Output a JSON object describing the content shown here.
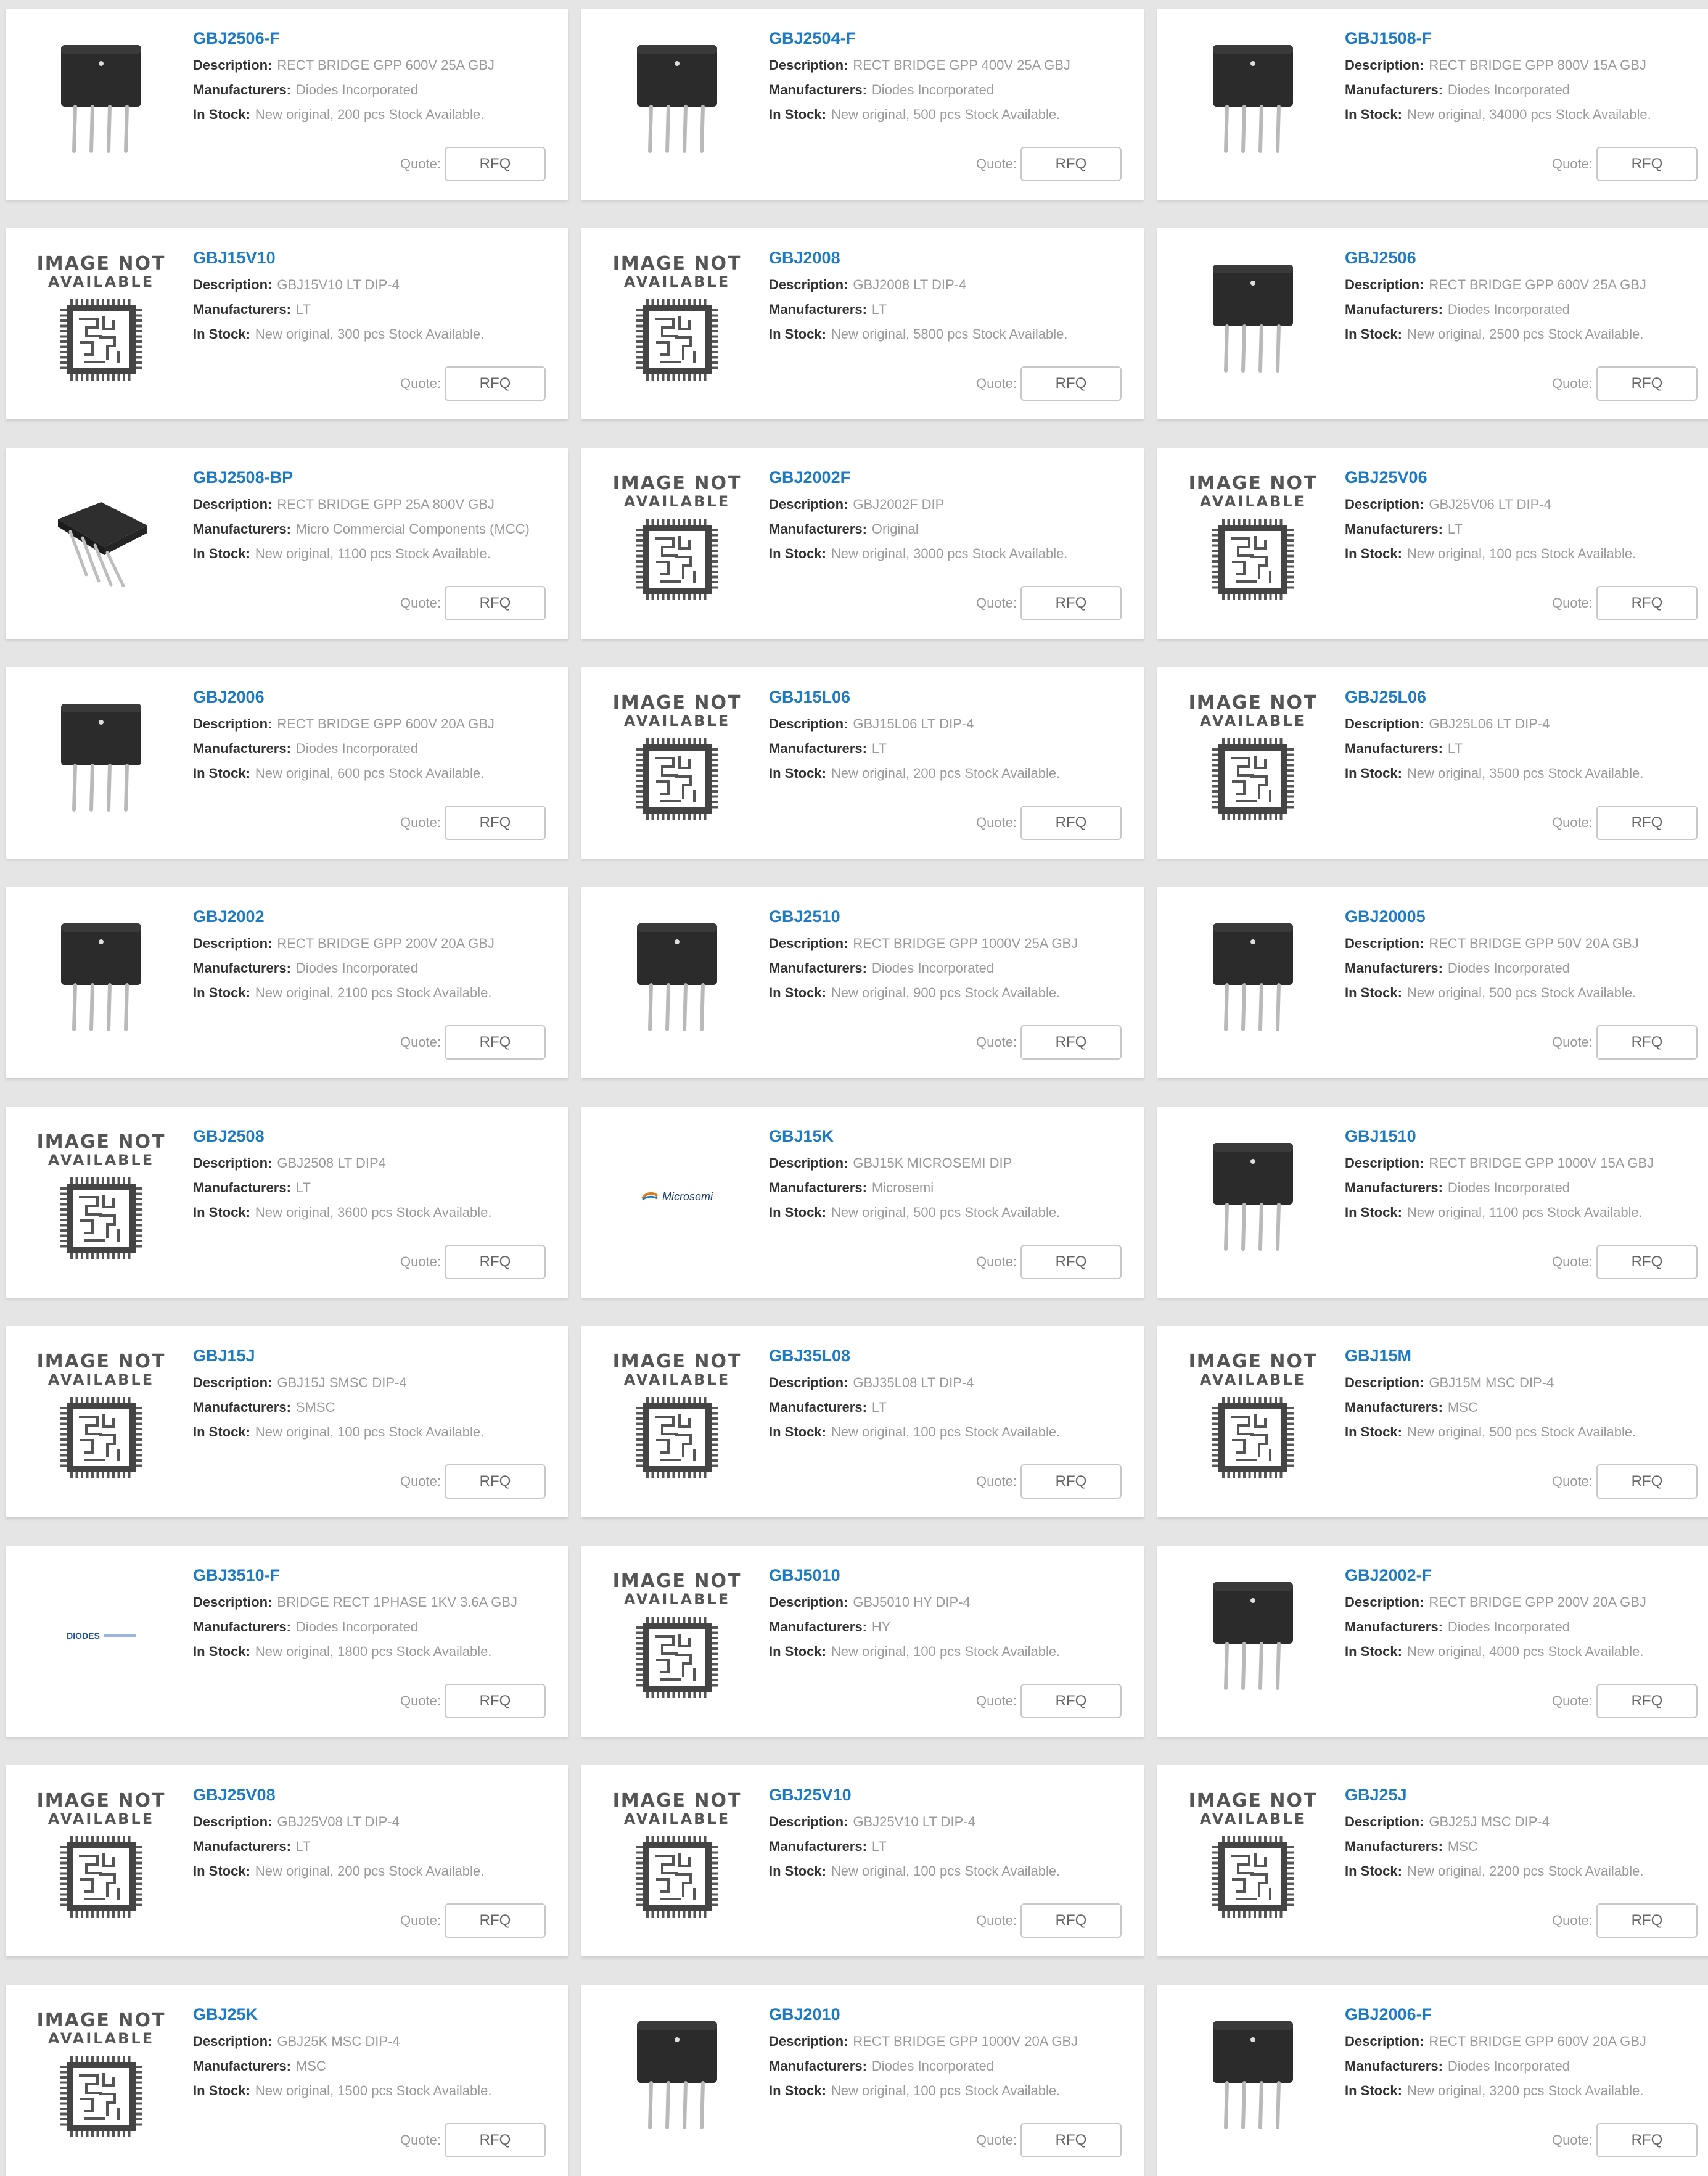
{
  "labels": {
    "description": "Description:",
    "manufacturers": "Manufacturers:",
    "in_stock": "In Stock:",
    "quote": "Quote:",
    "rfq": "RFQ"
  },
  "image_not_available": {
    "line1": "IMAGE NOT",
    "line2": "AVAILABLE"
  },
  "logos": {
    "microsemi": "Microsemi",
    "diodes": "DIODES"
  },
  "products": [
    {
      "pn": "GBJ2506-F",
      "desc": "RECT BRIDGE GPP 600V 25A GBJ",
      "mfr": "Diodes Incorporated",
      "stock": "New original, 200 pcs Stock Available.",
      "img": "bridge"
    },
    {
      "pn": "GBJ2504-F",
      "desc": "RECT BRIDGE GPP 400V 25A GBJ",
      "mfr": "Diodes Incorporated",
      "stock": "New original, 500 pcs Stock Available.",
      "img": "bridge"
    },
    {
      "pn": "GBJ1508-F",
      "desc": "RECT BRIDGE GPP 800V 15A GBJ",
      "mfr": "Diodes Incorporated",
      "stock": "New original, 34000 pcs Stock Available.",
      "img": "bridge"
    },
    {
      "pn": "GBJ15V10",
      "desc": "GBJ15V10 LT DIP-4",
      "mfr": "LT",
      "stock": "New original, 300 pcs Stock Available.",
      "img": "na"
    },
    {
      "pn": "GBJ2008",
      "desc": "GBJ2008 LT DIP-4",
      "mfr": "LT",
      "stock": "New original, 5800 pcs Stock Available.",
      "img": "na"
    },
    {
      "pn": "GBJ2506",
      "desc": "RECT BRIDGE GPP 600V 25A GBJ",
      "mfr": "Diodes Incorporated",
      "stock": "New original, 2500 pcs Stock Available.",
      "img": "bridge"
    },
    {
      "pn": "GBJ2508-BP",
      "desc": "RECT BRIDGE GPP 25A 800V GBJ",
      "mfr": "Micro Commercial Components (MCC)",
      "stock": "New original, 1100 pcs Stock Available.",
      "img": "bridge_angled"
    },
    {
      "pn": "GBJ2002F",
      "desc": "GBJ2002F    DIP",
      "mfr": "Original",
      "stock": "New original, 3000 pcs Stock Available.",
      "img": "na"
    },
    {
      "pn": "GBJ25V06",
      "desc": "GBJ25V06 LT DIP-4",
      "mfr": "LT",
      "stock": "New original, 100 pcs Stock Available.",
      "img": "na"
    },
    {
      "pn": "GBJ2006",
      "desc": "RECT BRIDGE GPP 600V 20A GBJ",
      "mfr": "Diodes Incorporated",
      "stock": "New original, 600 pcs Stock Available.",
      "img": "bridge"
    },
    {
      "pn": "GBJ15L06",
      "desc": "GBJ15L06 LT DIP-4",
      "mfr": "LT",
      "stock": "New original, 200 pcs Stock Available.",
      "img": "na"
    },
    {
      "pn": "GBJ25L06",
      "desc": "GBJ25L06 LT DIP-4",
      "mfr": "LT",
      "stock": "New original, 3500 pcs Stock Available.",
      "img": "na"
    },
    {
      "pn": "GBJ2002",
      "desc": "RECT BRIDGE GPP 200V 20A GBJ",
      "mfr": "Diodes Incorporated",
      "stock": "New original, 2100 pcs Stock Available.",
      "img": "bridge"
    },
    {
      "pn": "GBJ2510",
      "desc": "RECT BRIDGE GPP 1000V 25A GBJ",
      "mfr": "Diodes Incorporated",
      "stock": "New original, 900 pcs Stock Available.",
      "img": "bridge"
    },
    {
      "pn": "GBJ20005",
      "desc": "RECT BRIDGE GPP 50V 20A GBJ",
      "mfr": "Diodes Incorporated",
      "stock": "New original, 500 pcs Stock Available.",
      "img": "bridge"
    },
    {
      "pn": "GBJ2508",
      "desc": "GBJ2508 LT DIP4",
      "mfr": "LT",
      "stock": "New original, 3600 pcs Stock Available.",
      "img": "na"
    },
    {
      "pn": "GBJ15K",
      "desc": "GBJ15K MICROSEMI DIP",
      "mfr": "Microsemi",
      "stock": "New original, 500 pcs Stock Available.",
      "img": "microsemi"
    },
    {
      "pn": "GBJ1510",
      "desc": "RECT BRIDGE GPP 1000V 15A GBJ",
      "mfr": "Diodes Incorporated",
      "stock": "New original, 1100 pcs Stock Available.",
      "img": "bridge"
    },
    {
      "pn": "GBJ15J",
      "desc": "GBJ15J SMSC DIP-4",
      "mfr": "SMSC",
      "stock": "New original, 100 pcs Stock Available.",
      "img": "na"
    },
    {
      "pn": "GBJ35L08",
      "desc": "GBJ35L08 LT DIP-4",
      "mfr": "LT",
      "stock": "New original, 100 pcs Stock Available.",
      "img": "na"
    },
    {
      "pn": "GBJ15M",
      "desc": "GBJ15M MSC DIP-4",
      "mfr": "MSC",
      "stock": "New original, 500 pcs Stock Available.",
      "img": "na"
    },
    {
      "pn": "GBJ3510-F",
      "desc": "BRIDGE RECT 1PHASE 1KV 3.6A GBJ",
      "mfr": "Diodes Incorporated",
      "stock": "New original, 1800 pcs Stock Available.",
      "img": "diodes"
    },
    {
      "pn": "GBJ5010",
      "desc": "GBJ5010 HY DIP-4",
      "mfr": "HY",
      "stock": "New original, 100 pcs Stock Available.",
      "img": "na"
    },
    {
      "pn": "GBJ2002-F",
      "desc": "RECT BRIDGE GPP 200V 20A GBJ",
      "mfr": "Diodes Incorporated",
      "stock": "New original, 4000 pcs Stock Available.",
      "img": "bridge"
    },
    {
      "pn": "GBJ25V08",
      "desc": "GBJ25V08 LT DIP-4",
      "mfr": "LT",
      "stock": "New original, 200 pcs Stock Available.",
      "img": "na"
    },
    {
      "pn": "GBJ25V10",
      "desc": "GBJ25V10 LT DIP-4",
      "mfr": "LT",
      "stock": "New original, 100 pcs Stock Available.",
      "img": "na"
    },
    {
      "pn": "GBJ25J",
      "desc": "GBJ25J MSC DIP-4",
      "mfr": "MSC",
      "stock": "New original, 2200 pcs Stock Available.",
      "img": "na"
    },
    {
      "pn": "GBJ25K",
      "desc": "GBJ25K MSC DIP-4",
      "mfr": "MSC",
      "stock": "New original, 1500 pcs Stock Available.",
      "img": "na"
    },
    {
      "pn": "GBJ2010",
      "desc": "RECT BRIDGE GPP 1000V 20A GBJ",
      "mfr": "Diodes Incorporated",
      "stock": "New original, 100 pcs Stock Available.",
      "img": "bridge"
    },
    {
      "pn": "GBJ2006-F",
      "desc": "RECT BRIDGE GPP 600V 20A GBJ",
      "mfr": "Diodes Incorporated",
      "stock": "New original, 3200 pcs Stock Available.",
      "img": "bridge"
    }
  ]
}
